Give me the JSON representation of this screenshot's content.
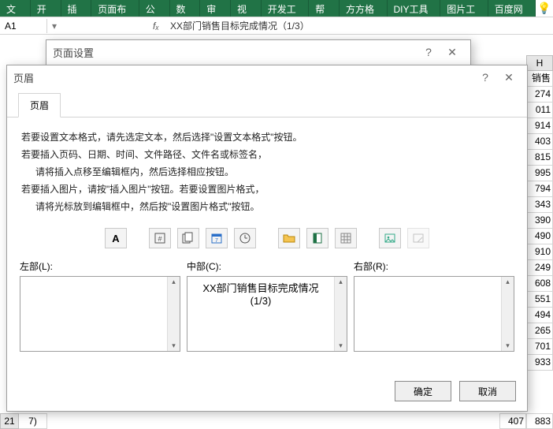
{
  "ribbon": {
    "tabs": [
      "文件",
      "开始",
      "插入",
      "页面布局",
      "公式",
      "数据",
      "审阅",
      "视图",
      "开发工具",
      "帮助",
      "方方格子",
      "DIY工具箱",
      "图片工具",
      "百度网盘"
    ]
  },
  "namebox": "A1",
  "formula": "XX部门销售目标完成情况（1/3）",
  "pageSetupDialog": {
    "title": "页面设置"
  },
  "headerDialog": {
    "title": "页眉",
    "tab": "页眉",
    "instructions": {
      "l1": "若要设置文本格式，请先选定文本，然后选择\"设置文本格式\"按钮。",
      "l2": "若要插入页码、日期、时间、文件路径、文件名或标签名，",
      "l3": "请将插入点移至编辑框内，然后选择相应按钮。",
      "l4": "若要插入图片，请按\"插入图片\"按钮。若要设置图片格式，",
      "l5": "请将光标放到编辑框中，然后按\"设置图片格式\"按钮。"
    },
    "labels": {
      "left": "左部(L):",
      "center": "中部(C):",
      "right": "右部(R):"
    },
    "centerText": "XX部门销售目标完成情况\n(1/3)",
    "buttons": {
      "ok": "确定",
      "cancel": "取消"
    },
    "iconNames": [
      "text-format",
      "page-number",
      "total-pages",
      "date",
      "time",
      "file-path",
      "file-name",
      "sheet-name",
      "insert-picture",
      "format-picture"
    ]
  },
  "grid": {
    "colHeader": "H",
    "topLabel": "销售",
    "values": [
      "274",
      "011",
      "914",
      "403",
      "815",
      "995",
      "794",
      "343",
      "390",
      "490",
      "910",
      "249",
      "608",
      "551",
      "494",
      "265",
      "701",
      "933"
    ],
    "bottomRow": {
      "hdr": "21",
      "cell": "7)",
      "rightVal": "407",
      "farRightVal": "883"
    }
  }
}
